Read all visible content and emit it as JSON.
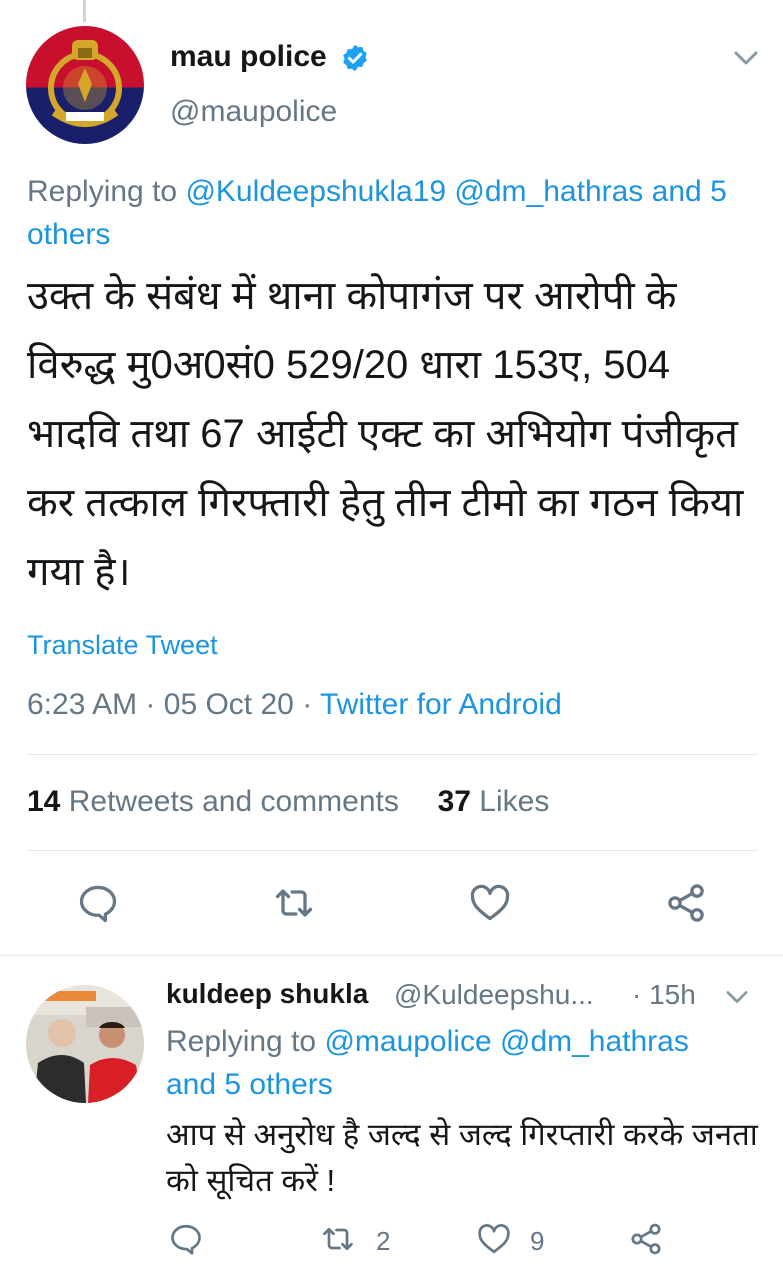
{
  "tweet": {
    "name": "mau police",
    "handle": "@maupolice",
    "replying_prefix": "Replying to",
    "replying_to": [
      "@Kuldeepshukla19",
      "@dm_hathras"
    ],
    "replying_and": "and",
    "replying_others": "5 others",
    "text": "उक्त के संबंध में थाना कोपागंज पर आरोपी के विरुद्ध मु0अ0सं0 529/20 धारा 153ए, 504 भादवि तथा 67 आईटी एक्ट का अभियोग पंजीकृत कर तत्काल गिरफ्तारी हेतु तीन टीमो का गठन किया गया है।",
    "translate_label": "Translate Tweet",
    "time": "6:23 AM",
    "sep": "·",
    "date": "05 Oct 20",
    "source": "Twitter for Android",
    "retweets_count": "14",
    "retweets_label": "Retweets and comments",
    "likes_count": "37",
    "likes_label": "Likes"
  },
  "reply": {
    "name": "kuldeep shukla",
    "handle": "@Kuldeepshu...",
    "time": "· 15h",
    "replying_prefix": "Replying to",
    "replying_to": [
      "@maupolice",
      "@dm_hathras"
    ],
    "replying_others": "and 5 others",
    "text": "आप से अनुरोध है जल्द से जल्द गिरप्तारी करके जनता को सूचित करें !",
    "retweet_count": "2",
    "like_count": "9"
  },
  "colors": {
    "link": "#1b95e0",
    "muted": "#657786",
    "icon": "#657786",
    "verified": "#1da1f2"
  }
}
